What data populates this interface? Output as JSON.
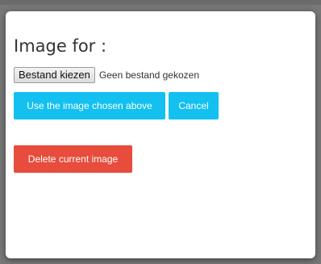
{
  "dialog": {
    "title": "Image for :",
    "file_input": {
      "button_label": "Bestand kiezen",
      "status_text": "Geen bestand gekozen"
    },
    "buttons": {
      "use_label": "Use the image chosen above",
      "cancel_label": "Cancel",
      "delete_label": "Delete current image"
    }
  },
  "colors": {
    "primary": "#13c0ef",
    "danger": "#e74c3c",
    "overlay": "#777777",
    "dialog_background": "#ffffff"
  }
}
